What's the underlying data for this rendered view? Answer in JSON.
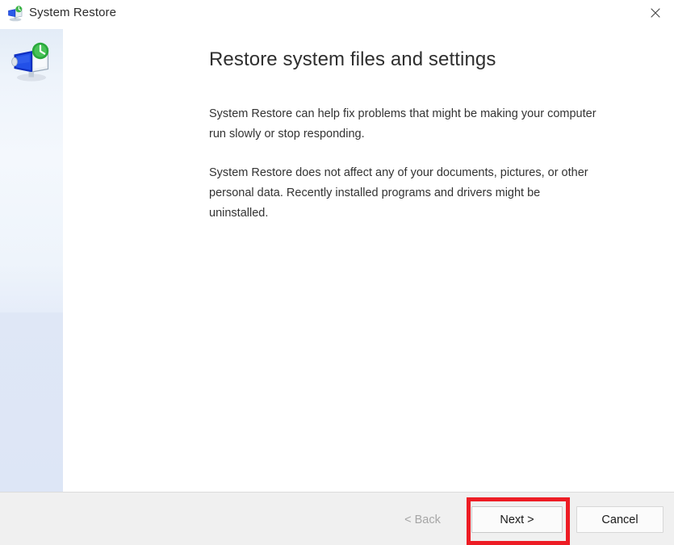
{
  "window": {
    "title": "System Restore",
    "title_icon": "system-restore-icon",
    "close_icon": "close-icon"
  },
  "sidebar": {
    "icon": "system-restore-computer-icon"
  },
  "content": {
    "heading": "Restore system files and settings",
    "paragraphs": [
      "System Restore can help fix problems that might be making your computer run slowly or stop responding.",
      "System Restore does not affect any of your documents, pictures, or other personal data. Recently installed programs and drivers might be uninstalled."
    ]
  },
  "footer": {
    "back_label": "< Back",
    "next_label": "Next >",
    "cancel_label": "Cancel"
  },
  "annotation": {
    "target": "next-button",
    "color": "#ed1c24"
  }
}
